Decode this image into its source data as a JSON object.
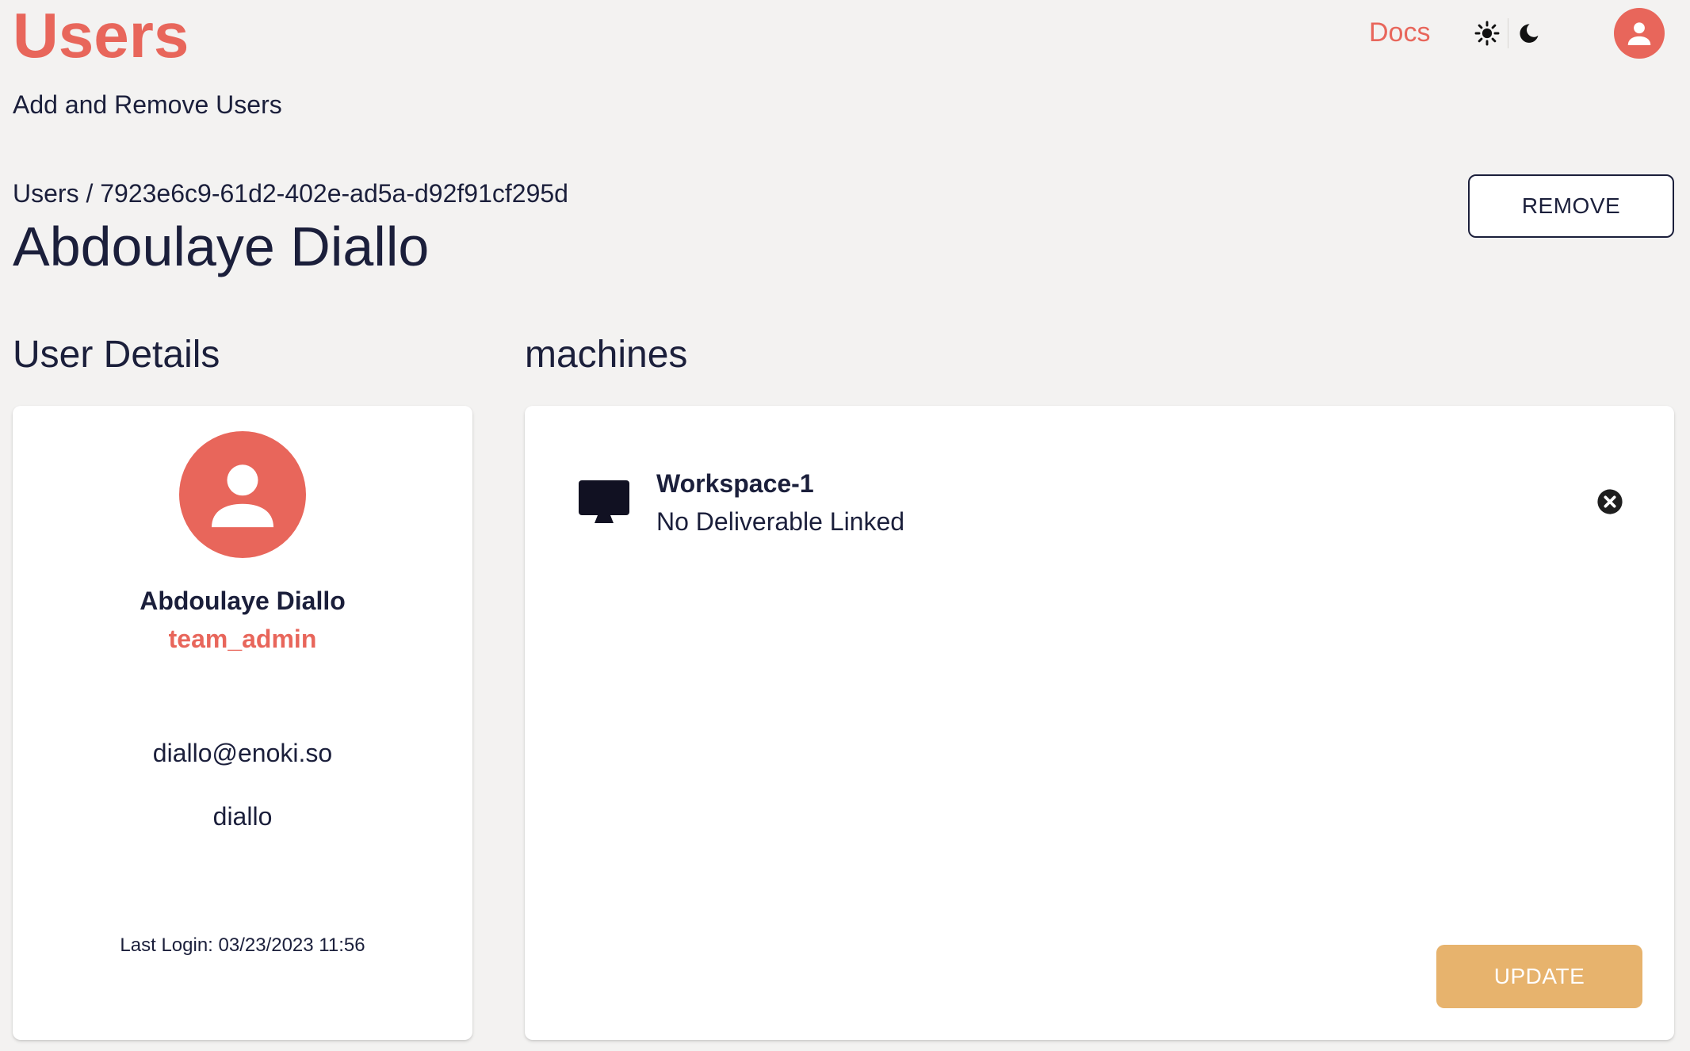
{
  "header": {
    "title": "Users",
    "subtitle": "Add and Remove Users",
    "docs_label": "Docs"
  },
  "breadcrumb": {
    "parent": "Users",
    "separator": " / ",
    "current": "7923e6c9-61d2-402e-ad5a-d92f91cf295d"
  },
  "user": {
    "name": "Abdoulaye Diallo",
    "role": "team_admin",
    "email": "diallo@enoki.so",
    "username": "diallo",
    "last_login": "Last Login: 03/23/2023 11:56"
  },
  "actions": {
    "remove_label": "REMOVE",
    "update_label": "UPDATE"
  },
  "sections": {
    "details_title": "User Details",
    "machines_title": "machines"
  },
  "machines": [
    {
      "name": "Workspace-1",
      "status": "No Deliverable Linked",
      "icon": "monitor-icon"
    }
  ],
  "icons": {
    "light_mode": "sun-icon",
    "dark_mode": "moon-icon",
    "account": "account-icon",
    "avatar": "person-icon",
    "remove_machine": "close-circle-icon"
  },
  "colors": {
    "background": "#f3f2f1",
    "accent": "#e8665b",
    "update_button": "#e7b36d",
    "text": "#1b1f3b",
    "card": "#ffffff"
  }
}
